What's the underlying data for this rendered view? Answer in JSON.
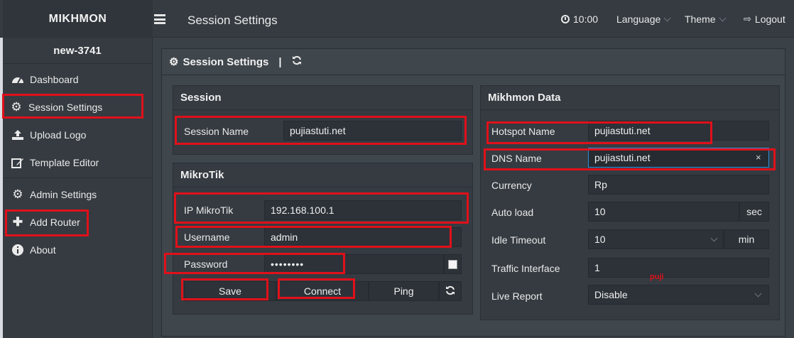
{
  "app": {
    "brand": "MIKHMON",
    "page_title": "Session Settings",
    "time": "10:00"
  },
  "topnav": {
    "language": "Language",
    "theme": "Theme",
    "logout": "Logout"
  },
  "sidebar": {
    "router": "new-3741",
    "items": [
      {
        "label": "Dashboard",
        "icon": "dashboard-icon"
      },
      {
        "label": "Session Settings",
        "icon": "gear-icon"
      },
      {
        "label": "Upload Logo",
        "icon": "upload-icon"
      },
      {
        "label": "Template Editor",
        "icon": "edit-icon"
      },
      {
        "label": "Admin Settings",
        "icon": "gear-icon"
      },
      {
        "label": "Add Router",
        "icon": "plus-icon"
      },
      {
        "label": "About",
        "icon": "info-icon"
      }
    ]
  },
  "main": {
    "title": "Session Settings",
    "separator": "|"
  },
  "session": {
    "title": "Session",
    "name_label": "Session Name",
    "name_value": "pujiastuti.net"
  },
  "mikrotik": {
    "title": "MikroTik",
    "ip_label": "IP MikroTik",
    "ip_value": "192.168.100.1",
    "user_label": "Username",
    "user_value": "admin",
    "pass_label": "Password",
    "pass_value": "••••••••",
    "save": "Save",
    "connect": "Connect",
    "ping": "Ping"
  },
  "mikhmon": {
    "title": "Mikhmon Data",
    "hotspot_label": "Hotspot Name",
    "hotspot_value": "pujiastuti.net",
    "dns_label": "DNS Name",
    "dns_value": "pujiastuti.net",
    "currency_label": "Currency",
    "currency_value": "Rp",
    "autoload_label": "Auto load",
    "autoload_value": "10",
    "autoload_unit": "sec",
    "idle_label": "Idle Timeout",
    "idle_value": "10",
    "idle_unit": "min",
    "traffic_label": "Traffic Interface",
    "traffic_value": "1",
    "live_label": "Live Report",
    "live_value": "Disable"
  },
  "annotation": {
    "watermark": "puji"
  },
  "colors": {
    "highlight": "#e0101a",
    "focus": "#2f8fe0",
    "background": "#3a4147"
  }
}
